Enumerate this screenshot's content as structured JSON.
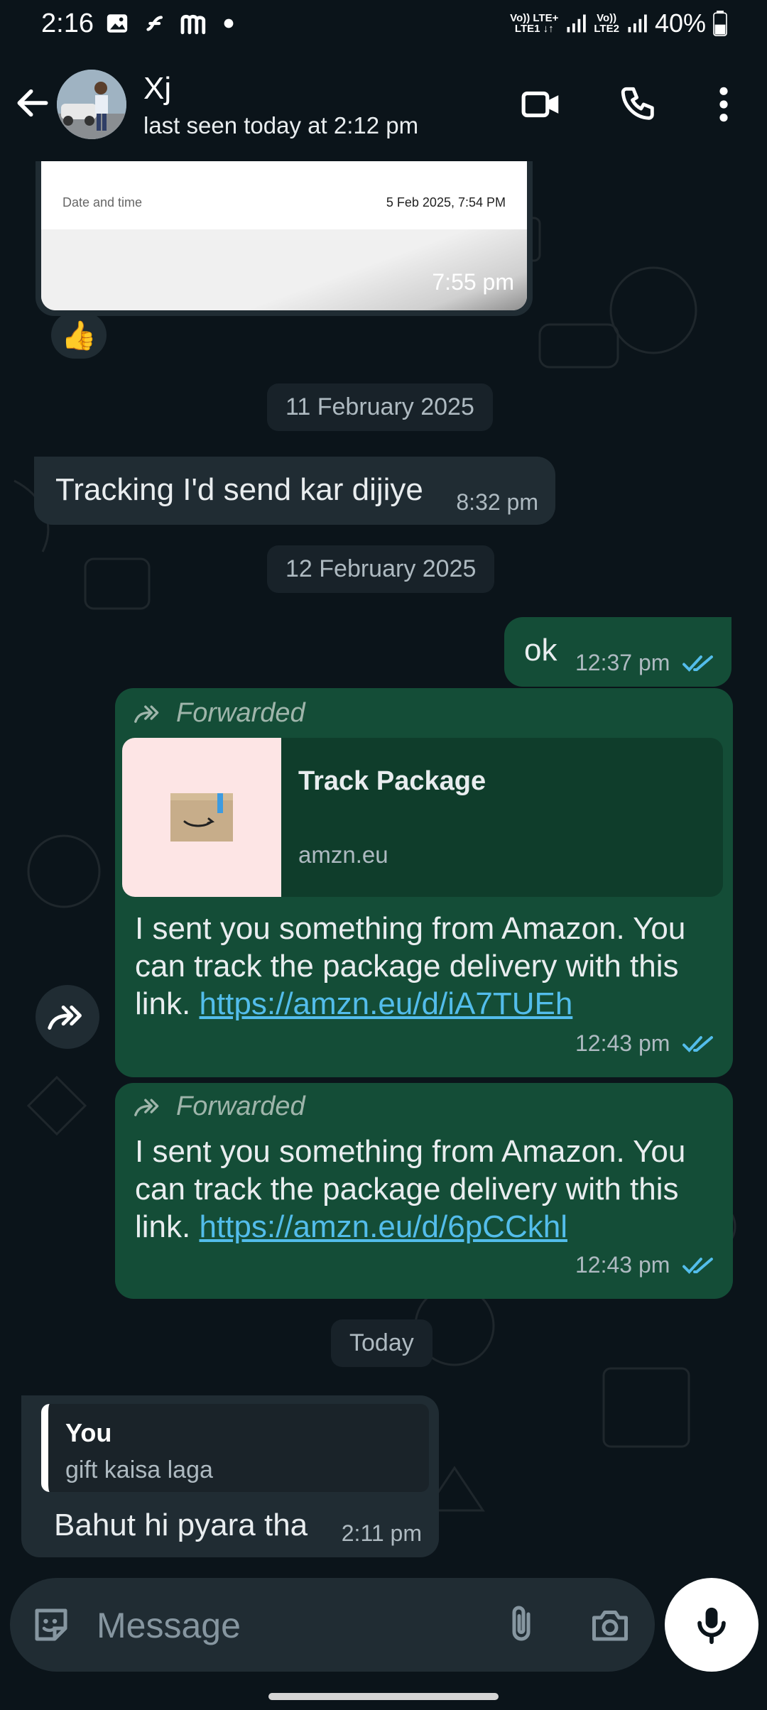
{
  "status_bar": {
    "time": "2:16",
    "net1_line1": "Vo)) LTE+",
    "net1_line2": "LTE1 ↓↑",
    "net2_line1": "Vo))",
    "net2_line2": "LTE2",
    "battery": "40%"
  },
  "header": {
    "name": "Xj",
    "last_seen": "last seen today at 2:12 pm"
  },
  "messages": {
    "image_card": {
      "row_label": "Date and time",
      "row_value": "5 Feb 2025, 7:54 PM",
      "time": "7:55 pm",
      "reaction": "👍"
    },
    "date1": "11 February 2025",
    "m1": {
      "text": "Tracking I'd send kar dijiye",
      "time": "8:32 pm"
    },
    "date2": "12 February 2025",
    "m2": {
      "text": "ok",
      "time": "12:37 pm"
    },
    "m3": {
      "forwarded": "Forwarded",
      "preview_title": "Track Package",
      "preview_domain": "amzn.eu",
      "text": "I sent you something from Amazon. You can track the package delivery with this link.",
      "link": "https://amzn.eu/d/iA7TUEh",
      "time": "12:43 pm"
    },
    "m4": {
      "forwarded": "Forwarded",
      "text": "I sent you something from Amazon. You can track the package delivery with this link.",
      "link": "https://amzn.eu/d/6pCCkhl",
      "time": "12:43 pm"
    },
    "date3": "Today",
    "m5": {
      "quote_author": "You",
      "quote_text": "gift kaisa laga",
      "text": "Bahut hi pyara tha",
      "time": "2:11 pm"
    }
  },
  "composer": {
    "placeholder": "Message"
  },
  "colors": {
    "background": "#0b141a",
    "incoming_bubble": "#202c33",
    "outgoing_bubble": "#144d37",
    "link": "#53bdeb",
    "read_ticks": "#53bdeb"
  }
}
